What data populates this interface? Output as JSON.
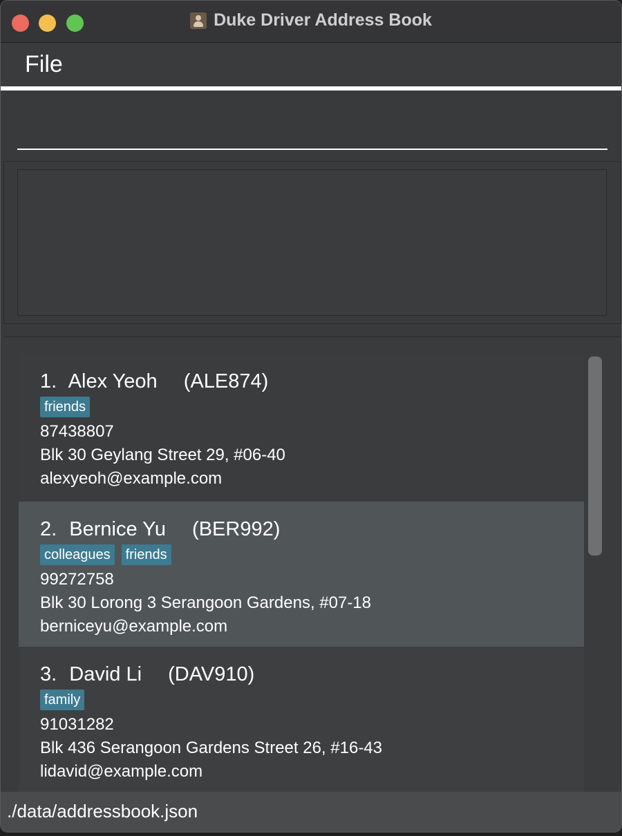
{
  "window": {
    "title": "Duke Driver Address Book",
    "icon": "address-book-icon"
  },
  "menu": {
    "file_label": "File"
  },
  "command": {
    "value": "",
    "placeholder": ""
  },
  "result": {
    "text": ""
  },
  "persons": [
    {
      "index": "1.",
      "name": "Alex Yeoh",
      "id": "(ALE874)",
      "tags": [
        "friends"
      ],
      "phone": "87438807",
      "address": "Blk 30 Geylang Street 29, #06-40",
      "email": "alexyeoh@example.com"
    },
    {
      "index": "2.",
      "name": "Bernice Yu",
      "id": "(BER992)",
      "tags": [
        "colleagues",
        "friends"
      ],
      "phone": "99272758",
      "address": "Blk 30 Lorong 3 Serangoon Gardens, #07-18",
      "email": "berniceyu@example.com"
    },
    {
      "index": "3.",
      "name": "David Li",
      "id": "(DAV910)",
      "tags": [
        "family"
      ],
      "phone": "91031282",
      "address": "Blk 436 Serangoon Gardens Street 26, #16-43",
      "email": "lidavid@example.com"
    }
  ],
  "status": {
    "file_path": "./data/addressbook.json"
  },
  "colors": {
    "background": "#393a3c",
    "tag": "#3e7b91",
    "selected_card": "#505558",
    "status_bar": "#4a4b4d"
  }
}
